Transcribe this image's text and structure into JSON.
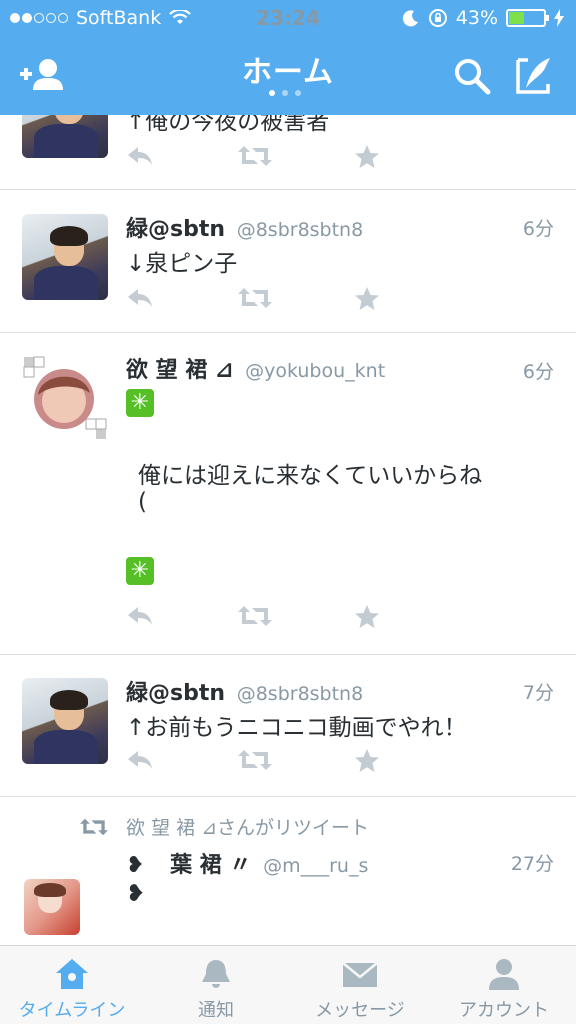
{
  "status_bar": {
    "carrier": "SoftBank",
    "time": "23:24",
    "battery_percent": "43%",
    "battery_level": 0.43,
    "signal_bars_filled": 2
  },
  "header": {
    "title": "ホーム",
    "page_count": 3,
    "active_page": 1
  },
  "tweets": [
    {
      "name": "",
      "handle": "",
      "time": "",
      "text": "↑俺の今夜の被害者"
    },
    {
      "name": "緑@sbtn",
      "handle": "@8sbr8sbtn8",
      "time": "6分",
      "text": "↓泉ピン子"
    },
    {
      "name": "欲 望 裙 ⊿",
      "handle": "@yokubou_knt",
      "time": "6分",
      "text_line1": "俺には迎えに来なくていいからね",
      "text_line2": "("
    },
    {
      "name": "緑@sbtn",
      "handle": "@8sbr8sbtn8",
      "time": "7分",
      "text": "↑お前もうニコニコ動画でやれ！"
    },
    {
      "retweet_label": "欲 望 裙 ⊿さんがリツイート",
      "name": "葉 裙 〃",
      "handle": "@m___ru_s",
      "time": "27分",
      "name_prefix": "❥",
      "text": "❥"
    }
  ],
  "tabbar": {
    "items": [
      {
        "label": "タイムライン",
        "icon": "home-icon",
        "active": true
      },
      {
        "label": "通知",
        "icon": "bell-icon",
        "active": false
      },
      {
        "label": "メッセージ",
        "icon": "envelope-icon",
        "active": false
      },
      {
        "label": "アカウント",
        "icon": "person-icon",
        "active": false
      }
    ]
  },
  "colors": {
    "brand": "#55acee",
    "text": "#292f33",
    "muted": "#8899a6",
    "action_icon": "#c3ccd3"
  }
}
